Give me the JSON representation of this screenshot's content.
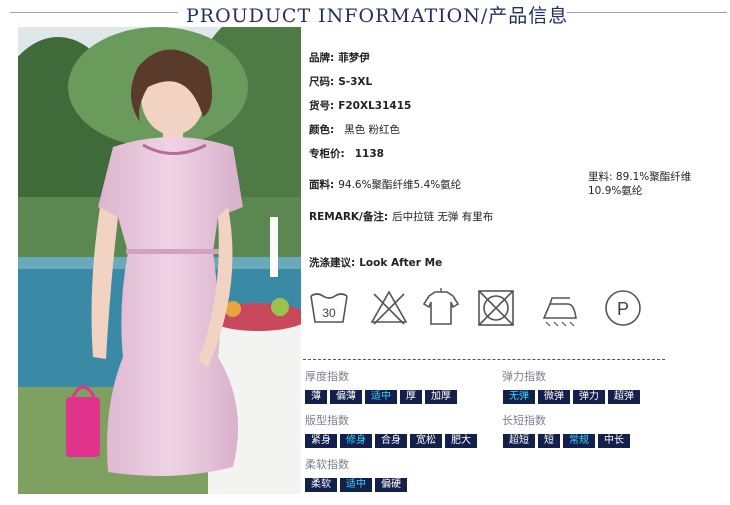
{
  "header": {
    "title": "PROUDUCT INFORMATION/产品信息"
  },
  "product": {
    "brand_label": "品牌:",
    "brand": "菲梦伊",
    "size_label": "尺码:",
    "size": "S-3XL",
    "sku_label": "货号:",
    "sku": "F20XL31415",
    "color_label": "颜色:",
    "colors": "黑色  粉红色",
    "price_label": "专柜价:",
    "price": "1138",
    "fabric_label": "面料:",
    "fabric": "94.6%聚酯纤维5.4%氨纶",
    "lining_label": "里料:",
    "lining_1": "89.1%聚酯纤维",
    "lining_2": "10.9%氨纶",
    "remark_label": "REMARK/备注:",
    "remark": "后中拉链 无弹 有里布",
    "wash_label": "洗涤建议:",
    "wash": "Look After Me"
  },
  "care_icons": [
    "wash-30-icon",
    "no-bleach-icon",
    "hang-dry-icon",
    "no-tumble-dry-icon",
    "iron-icon",
    "dry-clean-p-icon"
  ],
  "care_text": {
    "wash_temp": "30",
    "dryclean_letter": "P"
  },
  "indices": {
    "thickness": {
      "title": "厚度指数",
      "options": [
        "薄",
        "偏薄",
        "适中",
        "厚",
        "加厚"
      ],
      "selected": "适中"
    },
    "elasticity": {
      "title": "弹力指数",
      "options": [
        "无弹",
        "微弹",
        "弹力",
        "超弹"
      ],
      "selected": "无弹"
    },
    "fit": {
      "title": "版型指数",
      "options": [
        "紧身",
        "修身",
        "合身",
        "宽松",
        "肥大"
      ],
      "selected": "修身"
    },
    "length": {
      "title": "长短指数",
      "options": [
        "超短",
        "短",
        "常规",
        "中长"
      ],
      "selected": "常规"
    },
    "softness": {
      "title": "柔软指数",
      "options": [
        "柔软",
        "适中",
        "偏硬"
      ],
      "selected": "适中"
    }
  },
  "colors": {
    "navy": "#14204c",
    "selected_text": "#36d4ff",
    "title_blue": "#23305e",
    "dress_pink": "#e8c6dc"
  }
}
